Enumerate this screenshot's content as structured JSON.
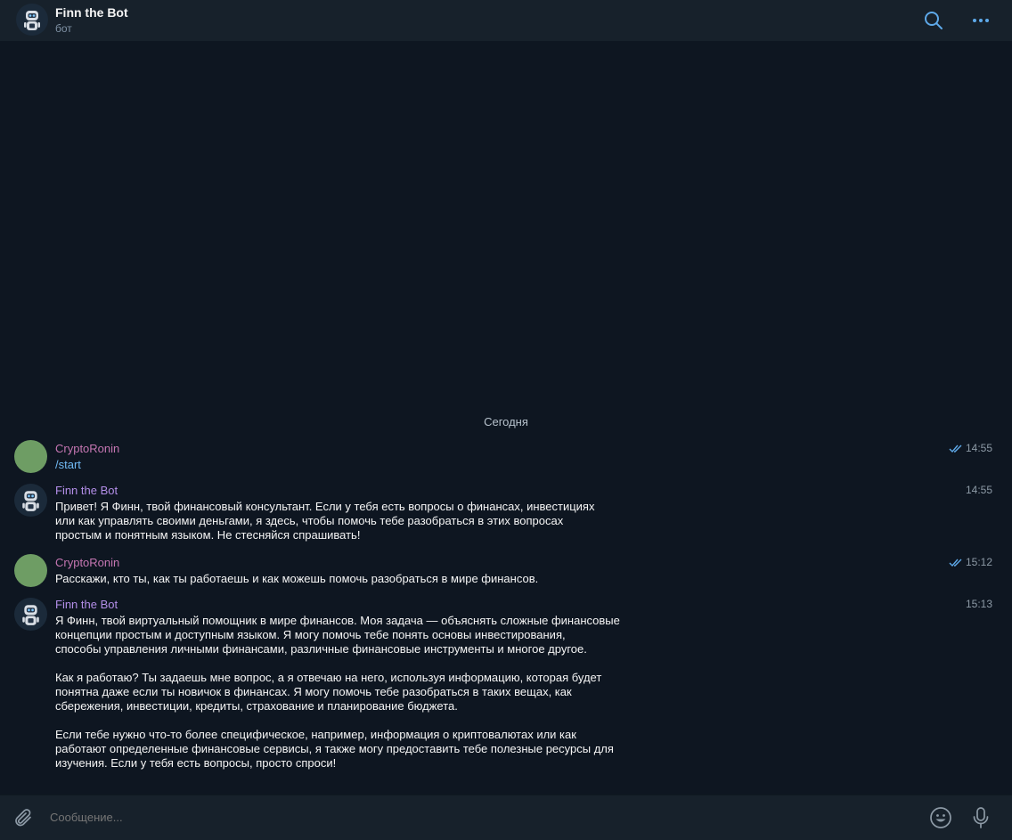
{
  "header": {
    "title": "Finn the Bot",
    "subtitle": "бот"
  },
  "date_separator": "Сегодня",
  "messages": [
    {
      "author": "CryptoRonin",
      "role": "user",
      "text": "/start",
      "time": "14:55",
      "read": true
    },
    {
      "author": "Finn the Bot",
      "role": "bot",
      "text": "Привет! Я Финн, твой финансовый консультант. Если у тебя есть вопросы о финансах, инвестициях\nили как управлять своими деньгами, я здесь, чтобы помочь тебе разобраться в этих вопросах\nпростым и понятным языком. Не стесняйся спрашивать!",
      "time": "14:55"
    },
    {
      "author": "CryptoRonin",
      "role": "user",
      "text": "Расскажи, кто ты, как ты работаешь и как можешь помочь разобраться в мире финансов.",
      "time": "15:12",
      "read": true
    },
    {
      "author": "Finn the Bot",
      "role": "bot",
      "text": "Я Финн, твой виртуальный помощник в мире финансов. Моя задача — объяснять сложные финансовые\nконцепции простым и доступным языком. Я могу помочь тебе понять основы инвестирования,\nспособы управления личными финансами, различные финансовые инструменты и многое другое.\n\nКак я работаю? Ты задаешь мне вопрос, а я отвечаю на него, используя информацию, которая будет\nпонятна даже если ты новичок в финансах. Я могу помочь тебе разобраться в таких вещах, как\nсбережения, инвестиции, кредиты, страхование и планирование бюджета.\n\nЕсли тебе нужно что-то более специфическое, например, информация о криптовалютах или как\nработают определенные финансовые сервисы, я также могу предоставить тебе полезные ресурсы для\nизучения. Если у тебя есть вопросы, просто спроси!",
      "time": "15:13"
    }
  ],
  "composer": {
    "placeholder": "Сообщение..."
  },
  "icons": {
    "header_search": "search-icon",
    "header_menu": "more-icon",
    "attach": "paperclip-icon",
    "emoji": "emoji-icon",
    "voice": "microphone-icon"
  },
  "colors": {
    "background": "#0e1621",
    "panel": "#17212b",
    "accent": "#5ea9e9",
    "user_name": "#c576b2",
    "bot_name": "#b38ee8",
    "user_avatar": "#6e9d64",
    "command_link": "#71baf4"
  }
}
